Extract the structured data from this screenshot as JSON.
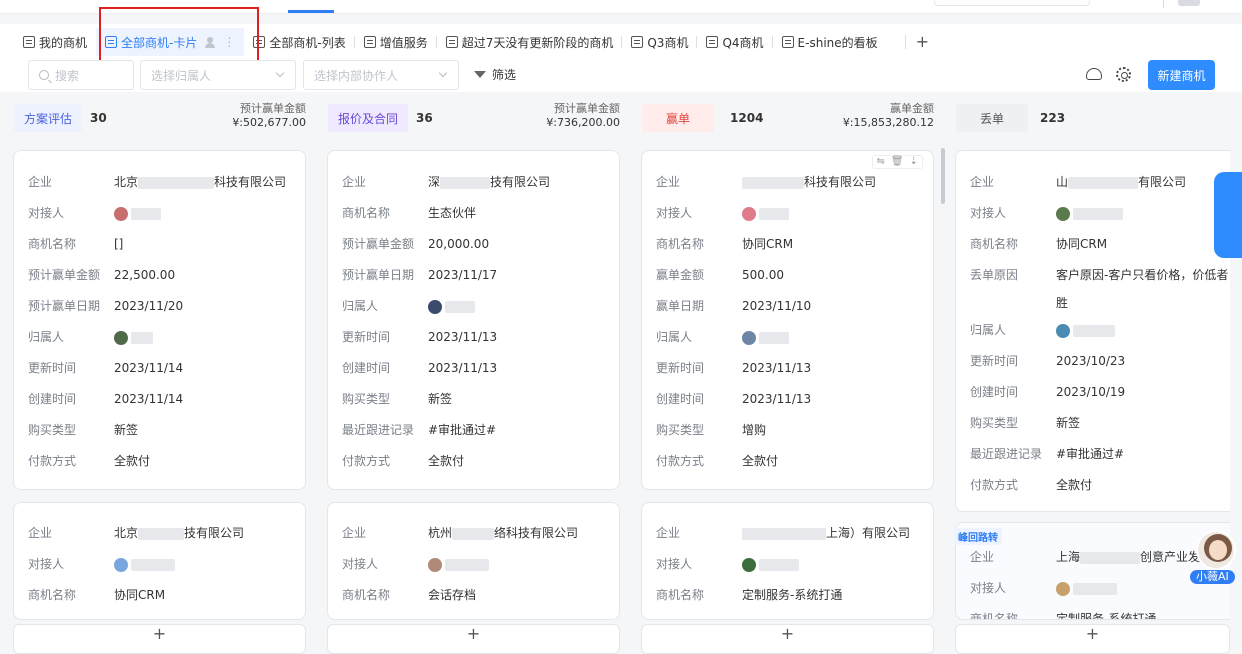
{
  "tabs": [
    {
      "label": "我的商机"
    },
    {
      "label": "全部商机-卡片"
    },
    {
      "label": "全部商机-列表"
    },
    {
      "label": "增值服务"
    },
    {
      "label": "超过7天没有更新阶段的商机"
    },
    {
      "label": "Q3商机"
    },
    {
      "label": "Q4商机"
    },
    {
      "label": "E-shine的看板"
    }
  ],
  "add_tab": "+",
  "toolbar": {
    "search_placeholder": "搜索",
    "owner_placeholder": "选择归属人",
    "collab_placeholder": "选择内部协作人",
    "filter_label": "筛选",
    "new_label": "新建商机"
  },
  "columns": [
    {
      "stage": "方案评估",
      "count": "30",
      "amount_label": "预计赢单金额",
      "amount": "¥:502,677.00",
      "tag_bg": "#eef2ff",
      "tag_color": "#4a63d9"
    },
    {
      "stage": "报价及合同",
      "count": "36",
      "amount_label": "预计赢单金额",
      "amount": "¥:736,200.00",
      "tag_bg": "#efeaff",
      "tag_color": "#6a47d8"
    },
    {
      "stage": "赢单",
      "count": "1204",
      "amount_label": "赢单金额",
      "amount": "¥:15,853,280.12",
      "tag_bg": "#ffeceb",
      "tag_color": "#e0443a"
    },
    {
      "stage": "丢单",
      "count": "223",
      "amount_label": "",
      "amount": "",
      "tag_bg": "#eef0f3",
      "tag_color": "#555555"
    }
  ],
  "cards": {
    "c1": [
      {
        "k": "企业",
        "v": "北京",
        "v2": "科技有限公司"
      },
      {
        "k": "对接人",
        "v": ""
      },
      {
        "k": "商机名称",
        "v": "[]"
      },
      {
        "k": "预计赢单金额",
        "v": "22,500.00"
      },
      {
        "k": "预计赢单日期",
        "v": "2023/11/20"
      },
      {
        "k": "归属人",
        "v": ""
      },
      {
        "k": "更新时间",
        "v": "2023/11/14"
      },
      {
        "k": "创建时间",
        "v": "2023/11/14"
      },
      {
        "k": "购买类型",
        "v": "新签"
      },
      {
        "k": "付款方式",
        "v": "全款付"
      }
    ],
    "c2": [
      {
        "k": "企业",
        "v": "深",
        "v2": "技有限公司"
      },
      {
        "k": "商机名称",
        "v": "生态伙伴"
      },
      {
        "k": "预计赢单金额",
        "v": "20,000.00"
      },
      {
        "k": "预计赢单日期",
        "v": "2023/11/17"
      },
      {
        "k": "归属人",
        "v": ""
      },
      {
        "k": "更新时间",
        "v": "2023/11/13"
      },
      {
        "k": "创建时间",
        "v": "2023/11/13"
      },
      {
        "k": "购买类型",
        "v": "新签"
      },
      {
        "k": "最近跟进记录",
        "v": "#审批通过#"
      },
      {
        "k": "付款方式",
        "v": "全款付"
      }
    ],
    "c3": [
      {
        "k": "企业",
        "v": "",
        "v2": "科技有限公司"
      },
      {
        "k": "对接人",
        "v": ""
      },
      {
        "k": "商机名称",
        "v": "协同CRM"
      },
      {
        "k": "赢单金额",
        "v": "500.00"
      },
      {
        "k": "赢单日期",
        "v": "2023/11/10"
      },
      {
        "k": "归属人",
        "v": ""
      },
      {
        "k": "更新时间",
        "v": "2023/11/13"
      },
      {
        "k": "创建时间",
        "v": "2023/11/13"
      },
      {
        "k": "购买类型",
        "v": "增购"
      },
      {
        "k": "付款方式",
        "v": "全款付"
      }
    ],
    "c4": [
      {
        "k": "企业",
        "v": "山",
        "v2": "有限公司"
      },
      {
        "k": "对接人",
        "v": ""
      },
      {
        "k": "商机名称",
        "v": "协同CRM"
      },
      {
        "k": "丢单原因",
        "v": "客户原因-客户只看价格，价低者胜"
      },
      {
        "k": "归属人",
        "v": ""
      },
      {
        "k": "更新时间",
        "v": "2023/10/23"
      },
      {
        "k": "创建时间",
        "v": "2023/10/19"
      },
      {
        "k": "购买类型",
        "v": "新签"
      },
      {
        "k": "最近跟进记录",
        "v": "#审批通过#"
      },
      {
        "k": "付款方式",
        "v": "全款付"
      }
    ],
    "c5": [
      {
        "k": "企业",
        "v": "北京",
        "v2": "技有限公司"
      },
      {
        "k": "对接人",
        "v": ""
      },
      {
        "k": "商机名称",
        "v": "协同CRM"
      }
    ],
    "c6": [
      {
        "k": "企业",
        "v": "杭州",
        "v2": "络科技有限公司"
      },
      {
        "k": "对接人",
        "v": ""
      },
      {
        "k": "商机名称",
        "v": "会话存档"
      }
    ],
    "c7": [
      {
        "k": "企业",
        "v": "",
        "v2": "上海）有限公司"
      },
      {
        "k": "对接人",
        "v": ""
      },
      {
        "k": "商机名称",
        "v": "定制服务-系统打通"
      }
    ],
    "c8": [
      {
        "k": "企业",
        "v": "上海",
        "v2": "创意产业发展"
      },
      {
        "k": "对接人",
        "v": ""
      },
      {
        "k": "商机名称",
        "v": "定制服务-系统打通"
      }
    ]
  },
  "c8_tag": "峰回路转",
  "ai_label": "小薇AI",
  "bottom_add": "+"
}
